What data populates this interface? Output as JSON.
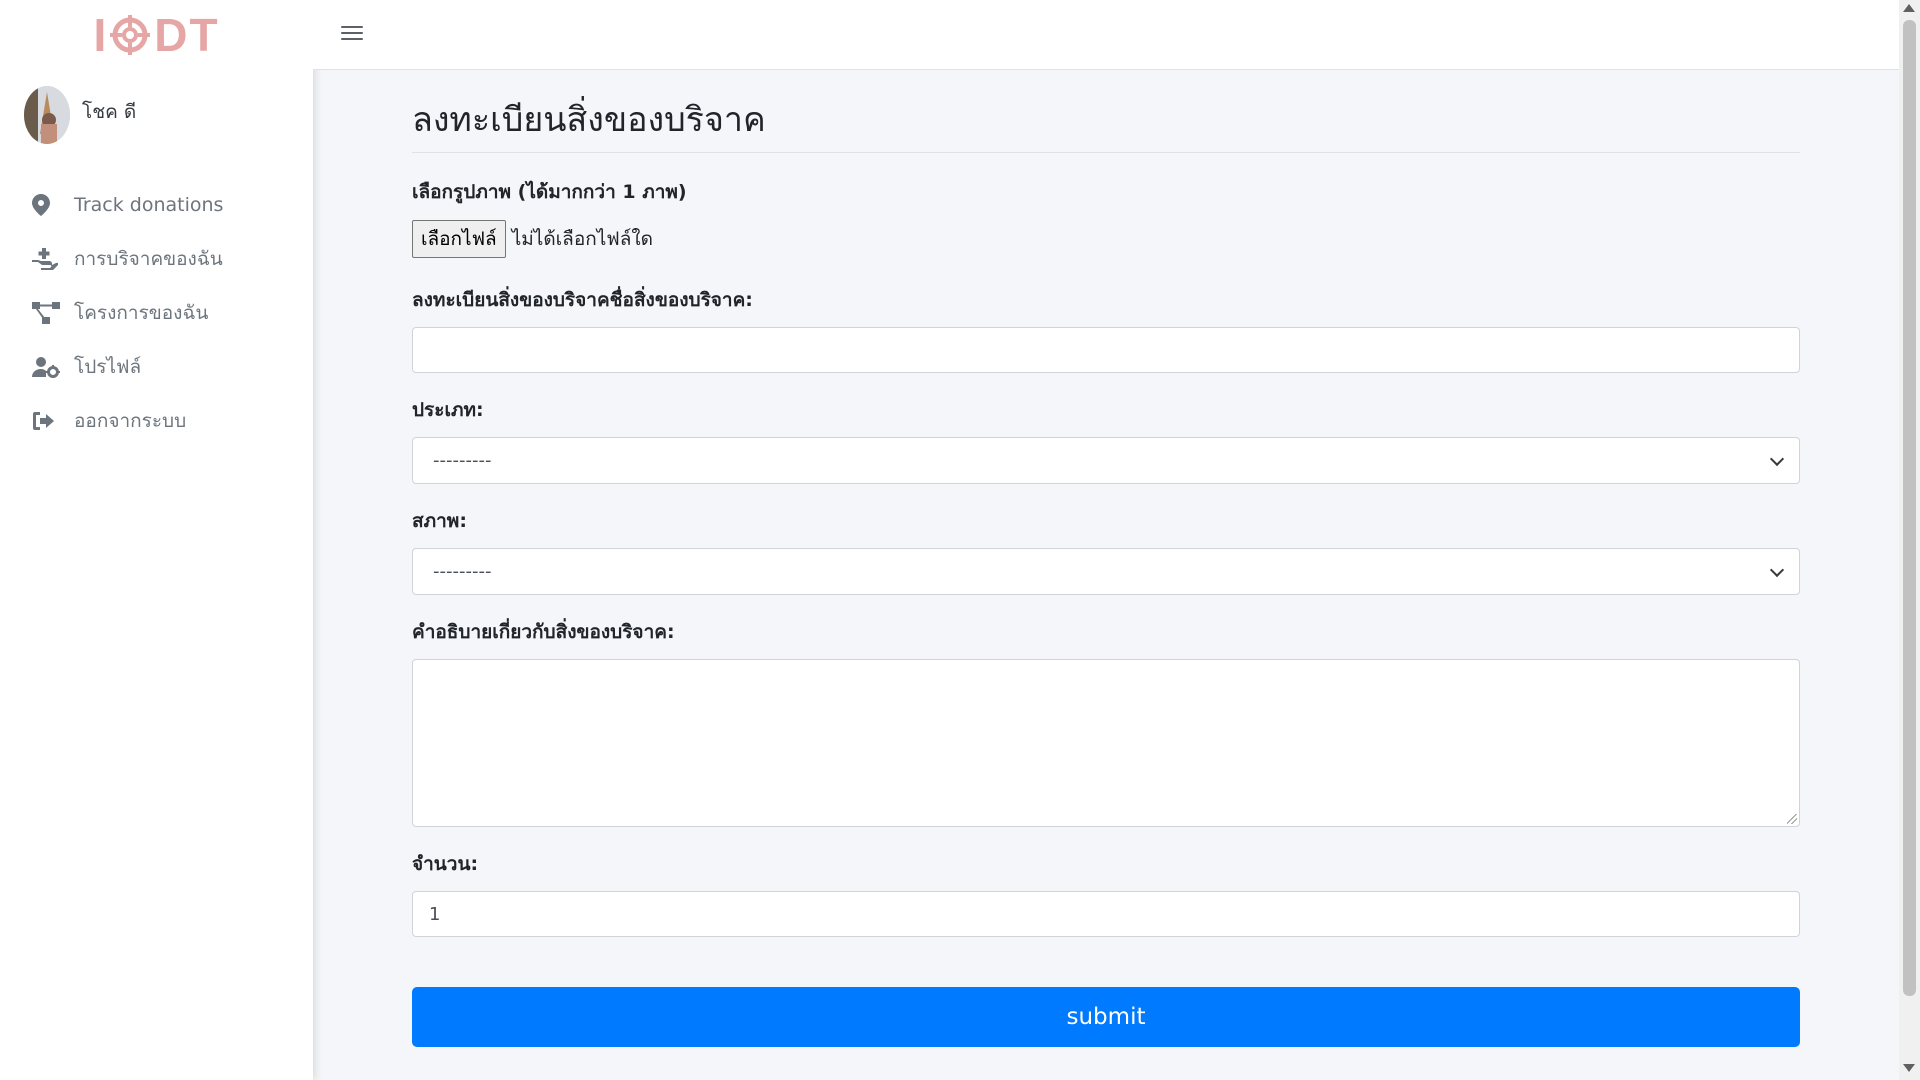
{
  "brand": {
    "name": "IODT"
  },
  "user": {
    "name": "โชค ดี"
  },
  "sidebar": {
    "items": [
      {
        "label": "Track donations",
        "icon": "map-marker-icon"
      },
      {
        "label": "การบริจาคของฉัน",
        "icon": "hand-holding-plus-icon"
      },
      {
        "label": "โครงการของฉัน",
        "icon": "project-diagram-icon"
      },
      {
        "label": "โปรไฟล์",
        "icon": "user-cog-icon"
      },
      {
        "label": "ออกจากระบบ",
        "icon": "sign-out-icon"
      }
    ]
  },
  "topbar": {
    "menu_icon": "hamburger-icon"
  },
  "page": {
    "title": "ลงทะเบียนสิ่งของบริจาค"
  },
  "form": {
    "image_label": "เลือกรูปภาพ (ได้มากกว่า 1 ภาพ)",
    "file_button": "เลือกไฟล์",
    "file_status": "ไม่ได้เลือกไฟล์ใด",
    "name_label": "ลงทะเบียนสิ่งของบริจาคชื่อสิ่งของบริจาค:",
    "name_value": "",
    "type_label": "ประเภท:",
    "type_selected": "---------",
    "condition_label": "สภาพ:",
    "condition_selected": "---------",
    "description_label": "คำอธิบายเกี่ยวกับสิ่งของบริจาค:",
    "description_value": "",
    "quantity_label": "จำนวน:",
    "quantity_value": "1",
    "submit_label": "submit"
  },
  "colors": {
    "primary": "#007bff",
    "brand": "#e7a6a6",
    "sidebar_text": "#6c757d"
  }
}
